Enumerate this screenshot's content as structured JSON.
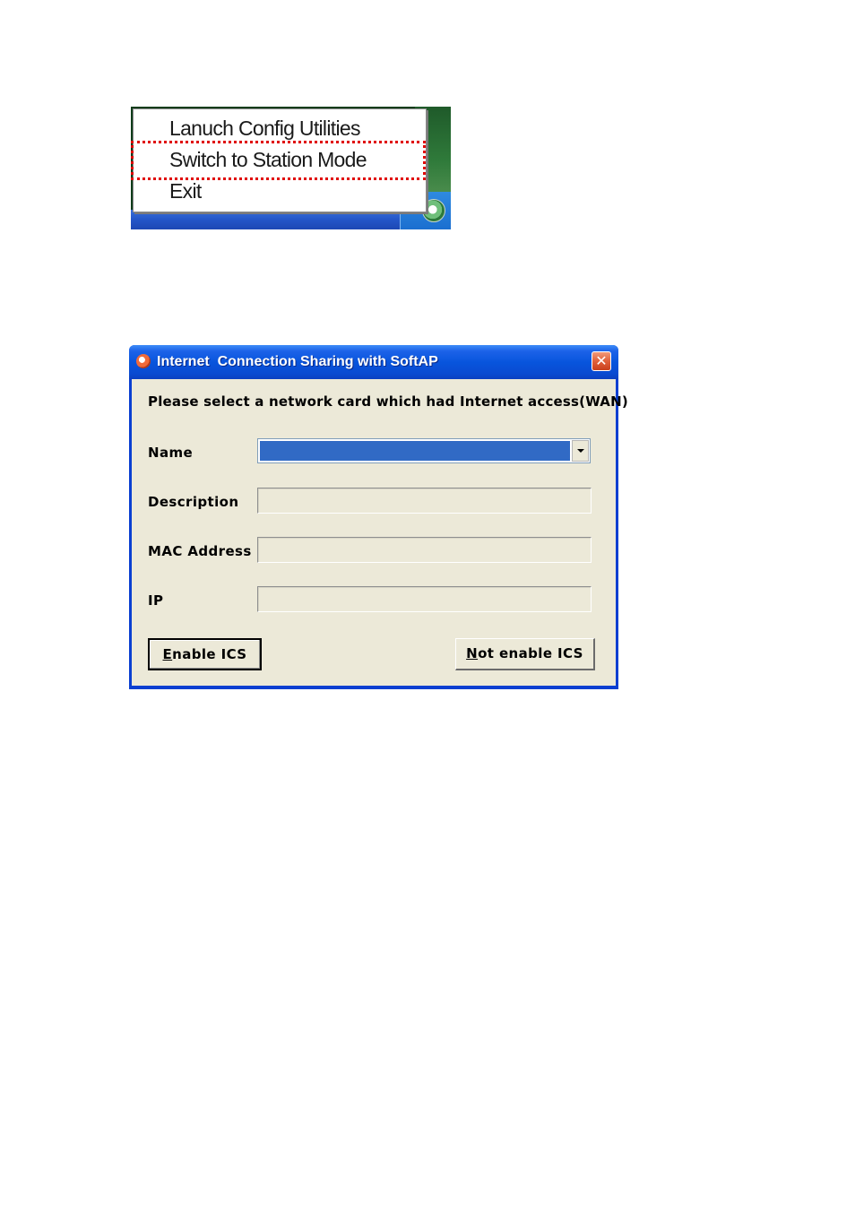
{
  "context_menu": {
    "items": [
      {
        "label": "Lanuch Config Utilities"
      },
      {
        "label": "Switch to Station Mode",
        "highlighted": true
      },
      {
        "label": "Exit"
      }
    ],
    "highlight_color": "#e00000",
    "tray_icon": "softap-tray-icon"
  },
  "dialog": {
    "title": "Internet  Connection Sharing with SoftAP",
    "title_icon": "softap-app-icon",
    "close_icon": "close-icon",
    "prompt": "Please select a network card which had Internet access(WAN)",
    "fields": {
      "name_label": "Name",
      "name_value": "",
      "description_label": "Description",
      "description_value": "",
      "mac_label": "MAC Address",
      "mac_value": "",
      "ip_label": "IP",
      "ip_value": ""
    },
    "buttons": {
      "enable_mnemonic": "E",
      "enable_rest": "nable ICS",
      "not_enable_mnemonic": "N",
      "not_enable_rest": "ot enable ICS"
    },
    "colors": {
      "titlebar": "#0855dd",
      "client": "#ece9d8",
      "selection": "#316ac5"
    }
  }
}
